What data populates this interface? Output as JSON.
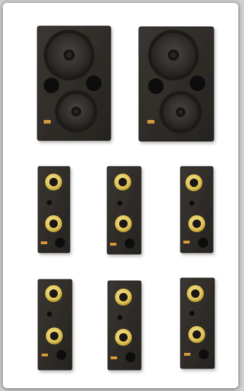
{
  "image": {
    "subject": "speaker-product-photo",
    "colors": {
      "background": "#ffffff",
      "cabinet": "#2f2c29",
      "cabinet_edge": "#1f1d1b",
      "woofer_cone": "#3a3633",
      "port": "#0b0b0b",
      "ring": "#e7cf61",
      "ring_dark": "#b79a34",
      "badge": "#d99a3a"
    },
    "items": [
      {
        "type": "large-3-way-monitor",
        "count": 2
      },
      {
        "type": "slim-in-wall-speaker",
        "count": 6
      }
    ]
  }
}
